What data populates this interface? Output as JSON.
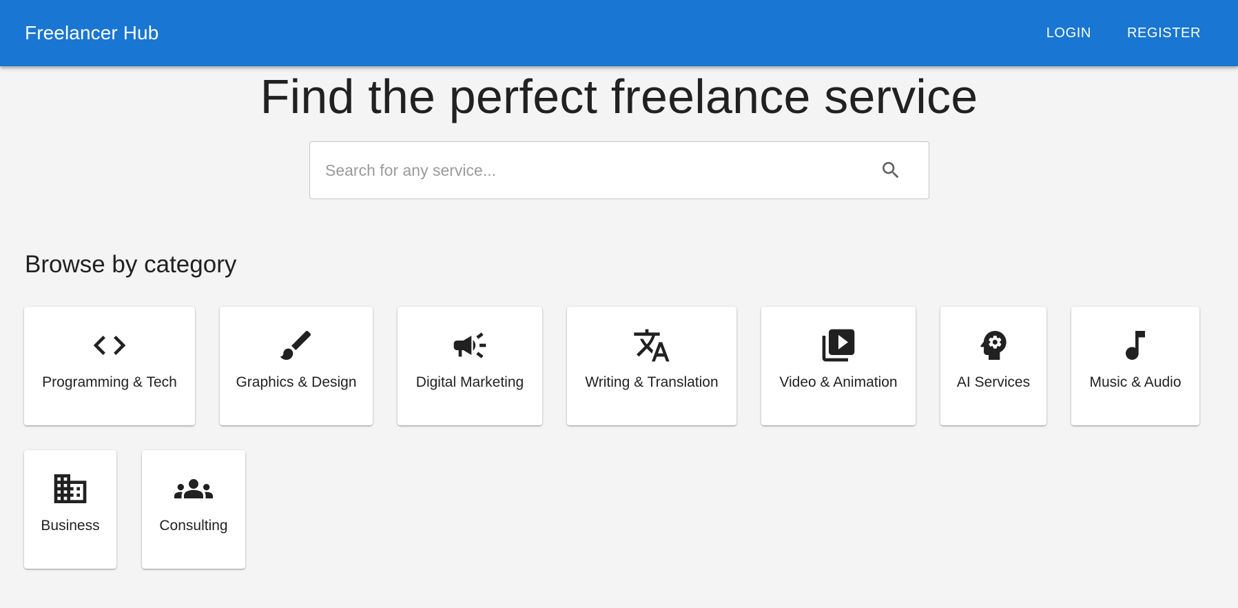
{
  "app": {
    "brand": "Freelancer Hub",
    "nav": {
      "login": "LOGIN",
      "register": "REGISTER"
    },
    "accent_color": "#1976d2"
  },
  "hero": {
    "title": "Find the perfect freelance service"
  },
  "search": {
    "placeholder": "Search for any service...",
    "value": "",
    "icon": "search-icon"
  },
  "categories": {
    "title": "Browse by category",
    "items": [
      {
        "label": "Programming & Tech",
        "icon": "code-icon"
      },
      {
        "label": "Graphics & Design",
        "icon": "brush-icon"
      },
      {
        "label": "Digital Marketing",
        "icon": "campaign-icon"
      },
      {
        "label": "Writing & Translation",
        "icon": "translate-icon"
      },
      {
        "label": "Video & Animation",
        "icon": "video-library-icon"
      },
      {
        "label": "AI Services",
        "icon": "psychology-icon"
      },
      {
        "label": "Music & Audio",
        "icon": "music-note-icon"
      },
      {
        "label": "Business",
        "icon": "business-icon"
      },
      {
        "label": "Consulting",
        "icon": "groups-icon"
      }
    ]
  }
}
